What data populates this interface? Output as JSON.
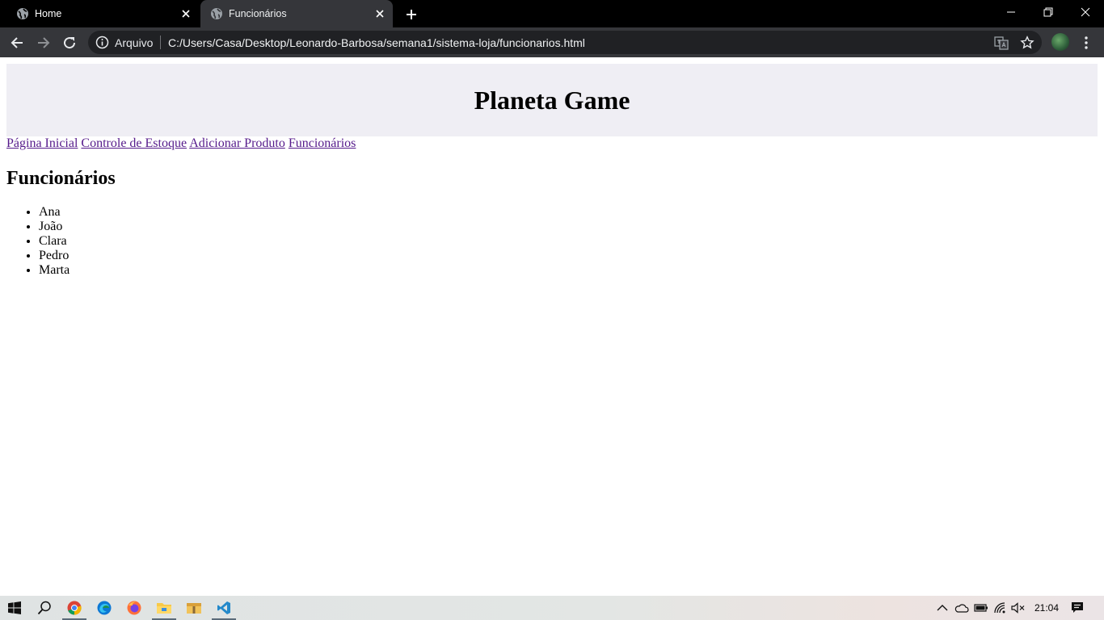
{
  "browser": {
    "tabs": [
      {
        "title": "Home",
        "active": false
      },
      {
        "title": "Funcionários",
        "active": true
      }
    ],
    "scheme_label": "Arquivo",
    "url": "C:/Users/Casa/Desktop/Leonardo-Barbosa/semana1/sistema-loja/funcionarios.html"
  },
  "page": {
    "site_title": "Planeta Game",
    "nav": [
      {
        "label": "Página Inicial"
      },
      {
        "label": "Controle de Estoque"
      },
      {
        "label": "Adicionar Produto"
      },
      {
        "label": "Funcionários"
      }
    ],
    "heading": "Funcionários",
    "employees": [
      "Ana",
      "João",
      "Clara",
      "Pedro",
      "Marta"
    ],
    "header_bg": "#efeef4",
    "link_color": "#551a8b"
  },
  "taskbar": {
    "apps": [
      "start-icon",
      "search-icon",
      "chrome-icon",
      "edge-icon",
      "firefox-icon",
      "file-explorer-icon",
      "archive-icon",
      "vscode-icon"
    ],
    "clock": "21:04"
  }
}
